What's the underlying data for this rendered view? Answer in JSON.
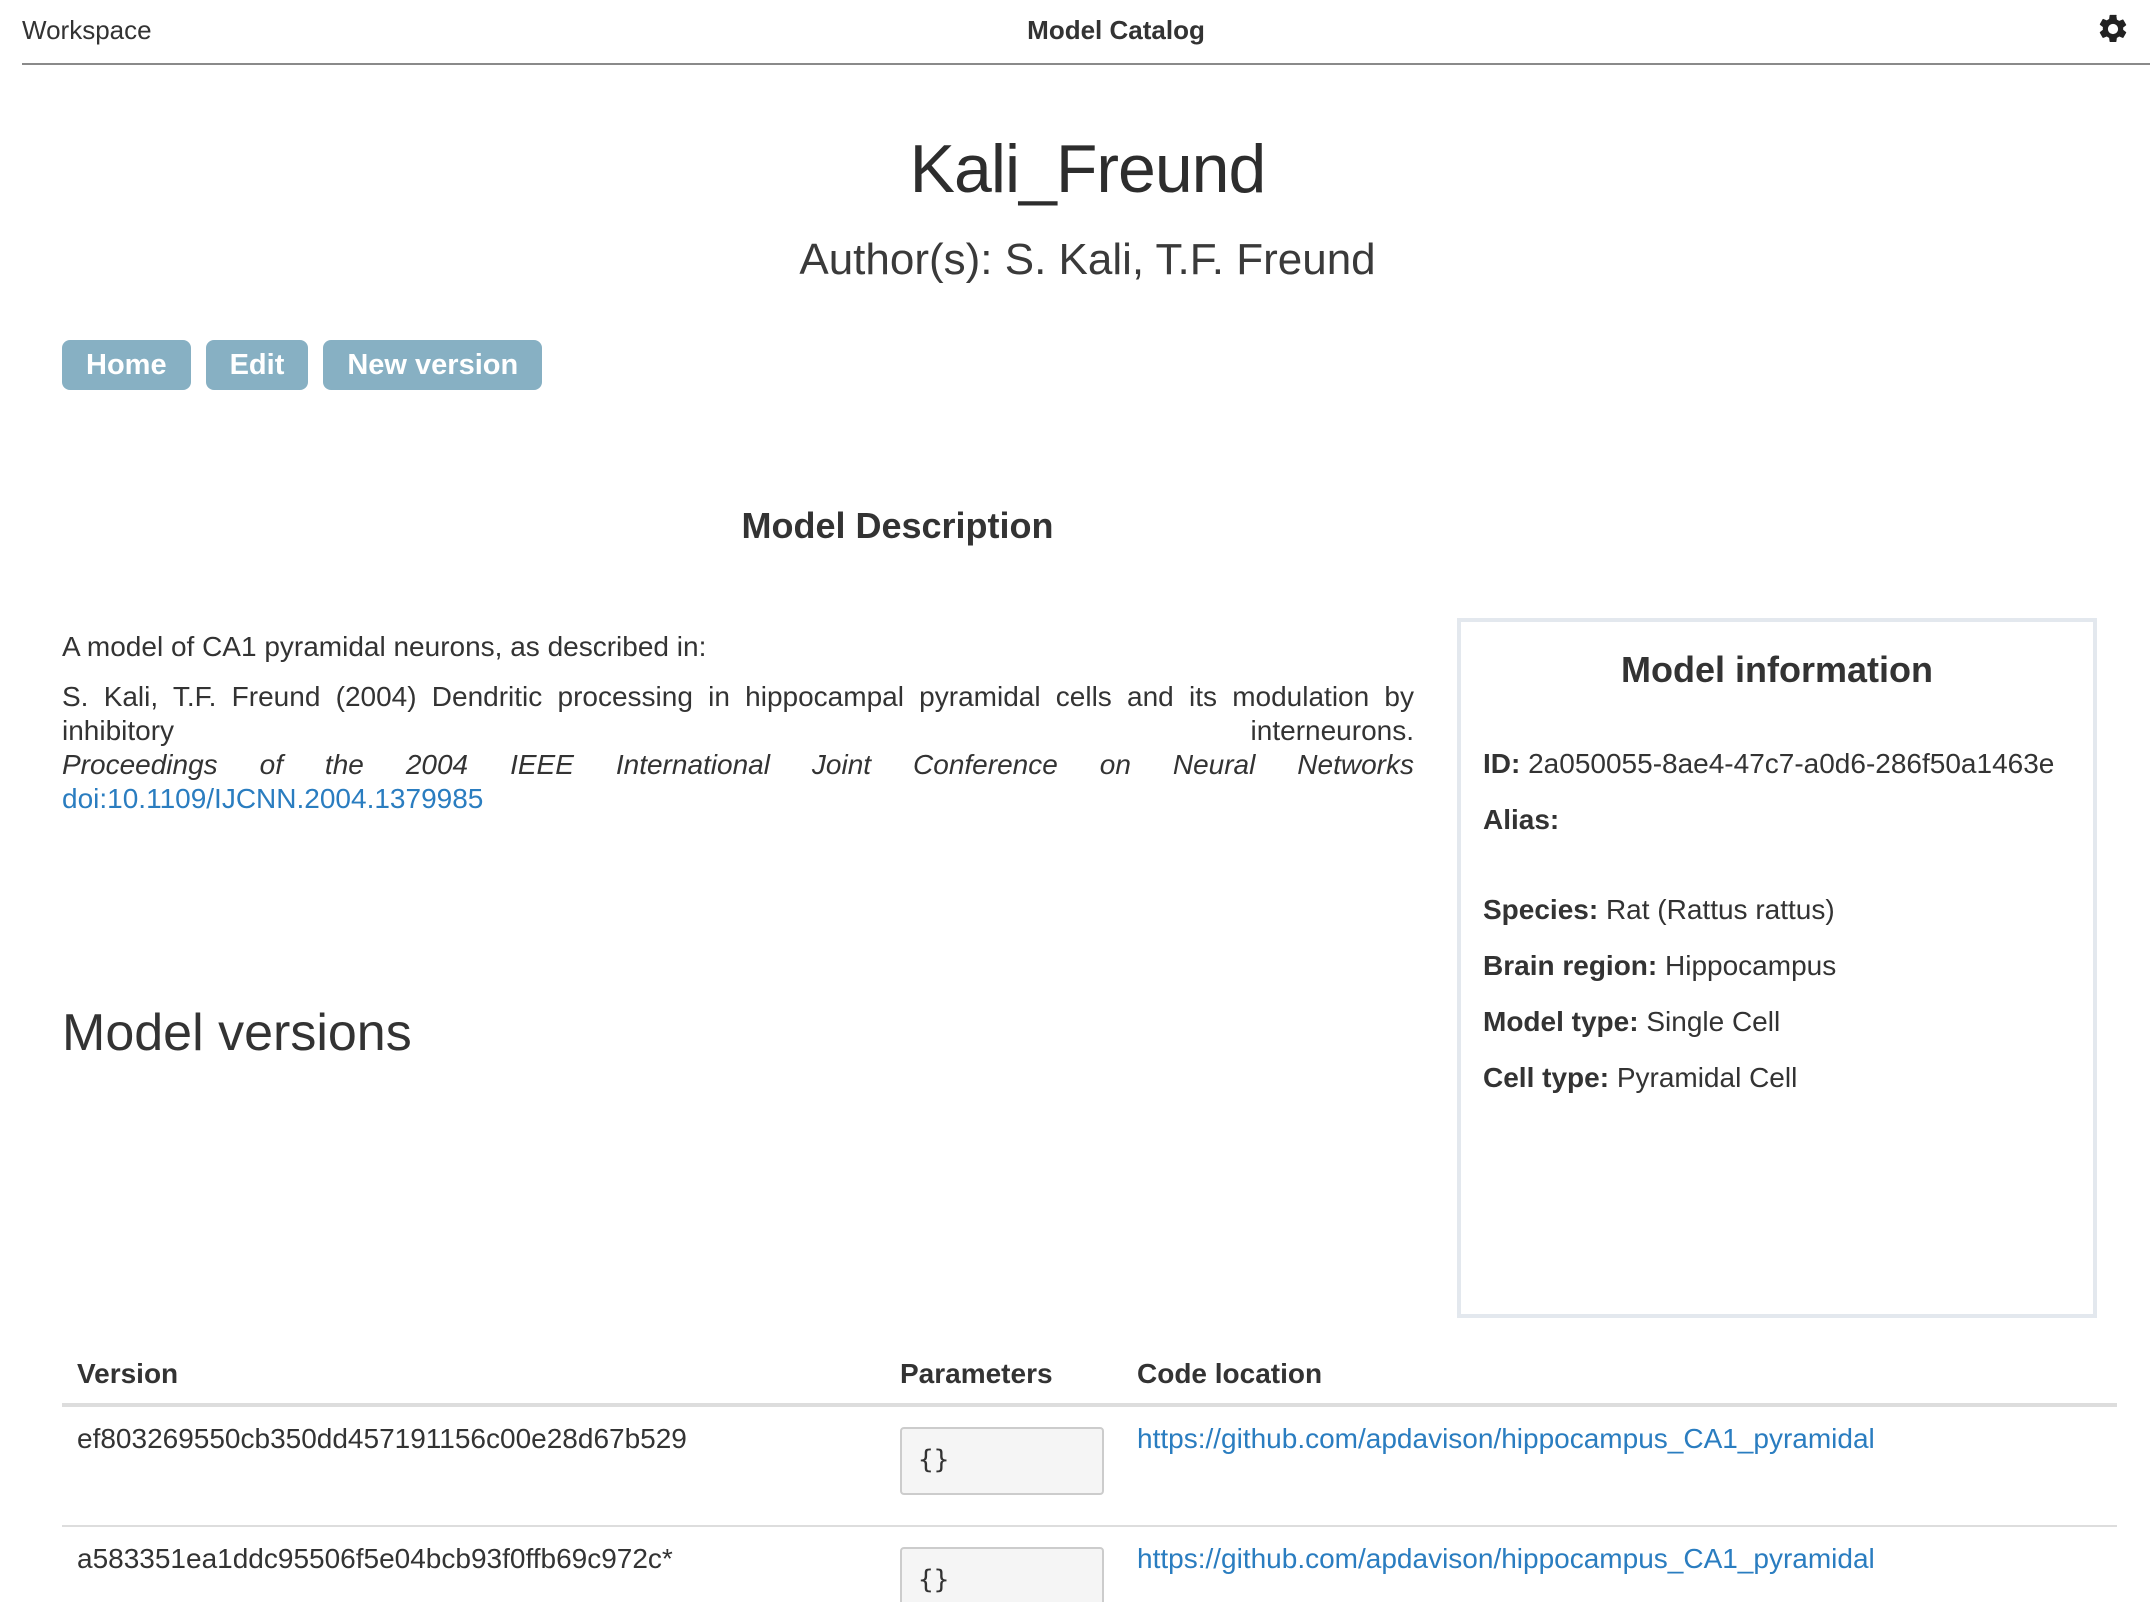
{
  "header": {
    "workspace": "Workspace",
    "app_title": "Model Catalog",
    "settings_icon": "gear-icon"
  },
  "model": {
    "name": "Kali_Freund",
    "authors": "Author(s): S. Kali, T.F. Freund"
  },
  "buttons": {
    "home": "Home",
    "edit": "Edit",
    "new_version": "New version"
  },
  "description": {
    "heading": "Model Description",
    "intro": "A model of CA1 pyramidal neurons, as described in:",
    "reference": "S. Kali, T.F. Freund (2004) Dendritic processing in hippocampal pyramidal cells and its modulation by inhibitory interneurons.",
    "journal": "Proceedings of the 2004 IEEE International Joint Conference on Neural Networks",
    "doi": "doi:10.1109/IJCNN.2004.1379985"
  },
  "info": {
    "heading": "Model information",
    "id_label": "ID:",
    "id_value": "2a050055-8ae4-47c7-a0d6-286f50a1463e",
    "alias_label": "Alias:",
    "alias_value": "",
    "species_label": "Species:",
    "species_value": "Rat (Rattus rattus)",
    "brain_region_label": "Brain region:",
    "brain_region_value": "Hippocampus",
    "model_type_label": "Model type:",
    "model_type_value": "Single Cell",
    "cell_type_label": "Cell type:",
    "cell_type_value": "Pyramidal Cell"
  },
  "versions": {
    "heading": "Model versions",
    "columns": [
      "Version",
      "Parameters",
      "Code location"
    ],
    "rows": [
      {
        "version": "ef803269550cb350dd457191156c00e28d67b529",
        "parameters": "{}",
        "code_location": "https://github.com/apdavison/hippocampus_CA1_pyramidal"
      },
      {
        "version": "a583351ea1ddc95506f5e04bcb93f0ffb69c972c*",
        "parameters": "{}",
        "code_location": "https://github.com/apdavison/hippocampus_CA1_pyramidal"
      }
    ]
  }
}
